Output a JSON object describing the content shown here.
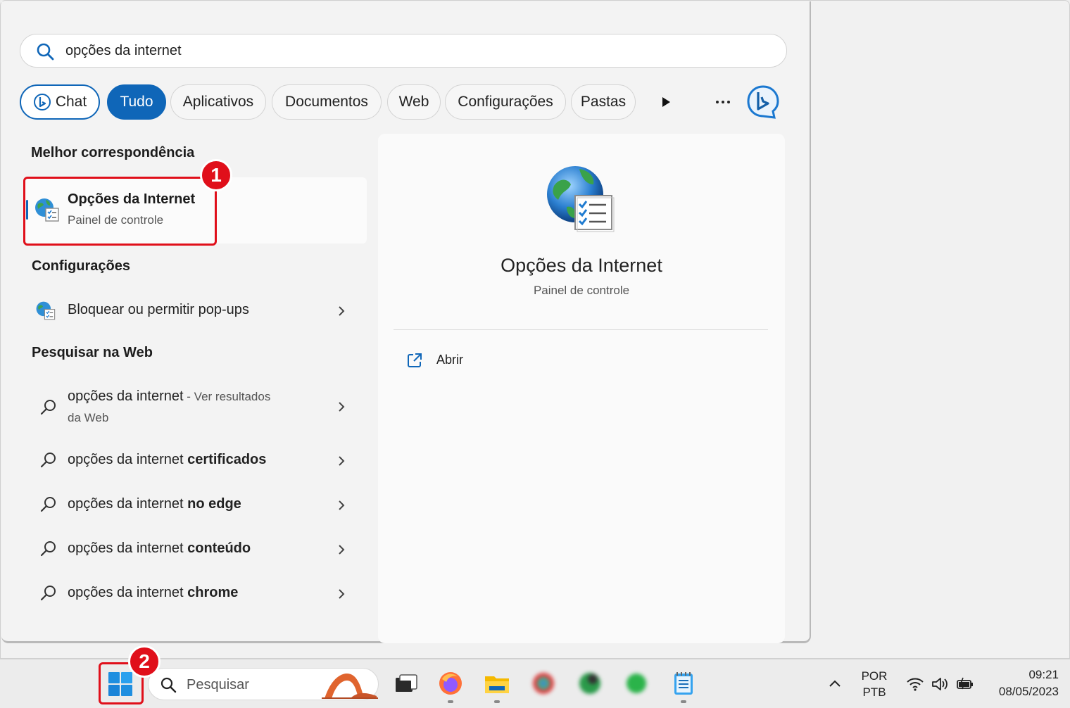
{
  "search": {
    "query": "opções da internet"
  },
  "filters": {
    "chat": "Chat",
    "items": [
      "Tudo",
      "Aplicativos",
      "Documentos",
      "Web",
      "Configurações",
      "Pastas"
    ],
    "active": "Tudo"
  },
  "best_match": {
    "heading": "Melhor correspondência",
    "title": "Opções da Internet",
    "subtitle": "Painel de controle"
  },
  "settings": {
    "heading": "Configurações",
    "items": [
      {
        "label": "Bloquear ou permitir pop-ups"
      }
    ]
  },
  "web": {
    "heading": "Pesquisar na Web",
    "first": {
      "query": "opções da internet",
      "suffix": " - Ver resultados",
      "line2": "da Web"
    },
    "items": [
      {
        "prefix": "opções da internet ",
        "bold": "certificados"
      },
      {
        "prefix": "opções da internet ",
        "bold": "no edge"
      },
      {
        "prefix": "opções da internet ",
        "bold": "conteúdo"
      },
      {
        "prefix": "opções da internet ",
        "bold": "chrome"
      }
    ]
  },
  "detail": {
    "title": "Opções da Internet",
    "subtitle": "Painel de controle",
    "action": "Abrir"
  },
  "annotations": {
    "marker1": "1",
    "marker2": "2"
  },
  "taskbar": {
    "search_placeholder": "Pesquisar",
    "lang_line1": "POR",
    "lang_line2": "PTB",
    "time": "09:21",
    "date": "08/05/2023"
  },
  "colors": {
    "accent": "#0f66b8",
    "annotation": "#e00f1a"
  },
  "icons": [
    "search-icon",
    "bing-icon",
    "play-arrow-icon",
    "more-icon",
    "internet-options-icon",
    "chevron-right-icon",
    "open-external-icon",
    "windows-start-icon",
    "wifi-icon",
    "volume-icon",
    "battery-icon"
  ]
}
